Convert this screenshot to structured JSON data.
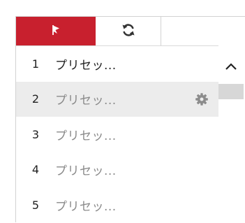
{
  "tabs": [
    {
      "icon": "flag-icon",
      "active": true
    },
    {
      "icon": "refresh-icon",
      "active": false
    },
    {
      "icon": "",
      "active": false
    }
  ],
  "presets": [
    {
      "number": "1",
      "name": "プリセッ...",
      "selected": false
    },
    {
      "number": "2",
      "name": "プリセッ...",
      "selected": true
    },
    {
      "number": "3",
      "name": "プリセッ...",
      "selected": false
    },
    {
      "number": "4",
      "name": "プリセッ...",
      "selected": false
    },
    {
      "number": "5",
      "name": "プリセッ...",
      "selected": false
    }
  ],
  "colors": {
    "accent": "#c8202e",
    "selected_row": "#ececec",
    "border": "#d2d2d2"
  }
}
